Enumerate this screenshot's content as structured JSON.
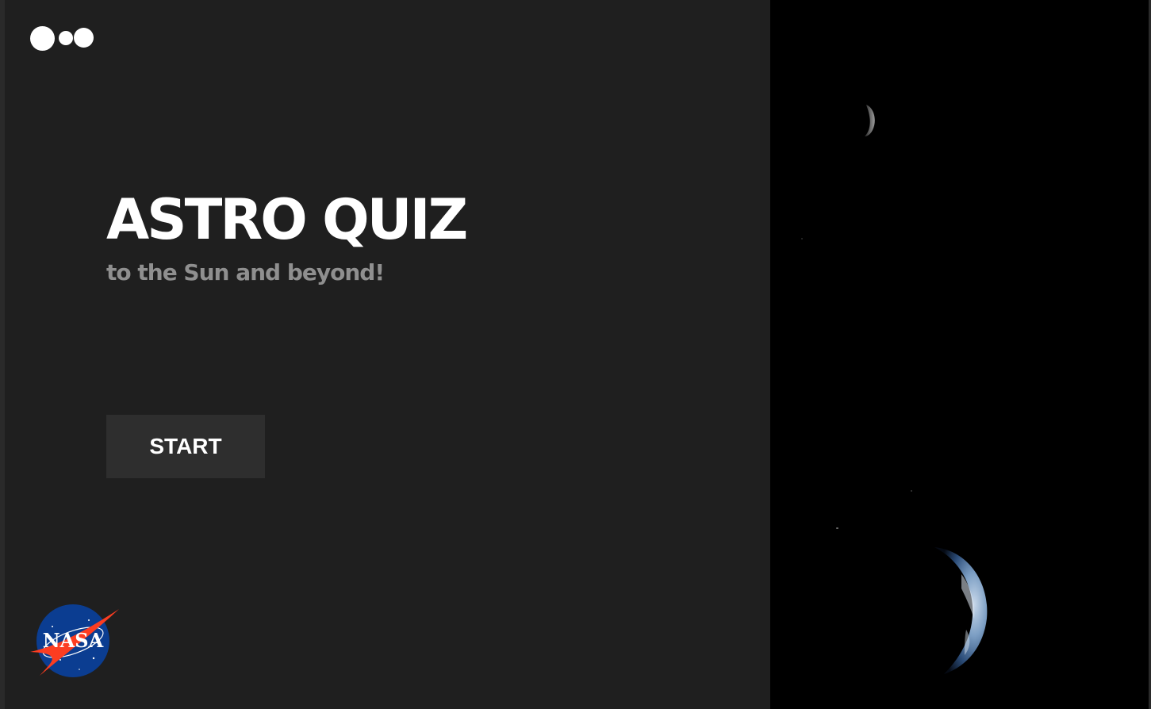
{
  "app": {
    "title": "ASTRO QUIZ",
    "subtitle": "to the Sun and beyond!"
  },
  "actions": {
    "start_label": "START"
  },
  "branding": {
    "logo_icon": "three-dots-logo-icon",
    "nasa_logo_text": "NASA",
    "nasa_logo_icon": "nasa-meatball-logo-icon"
  },
  "imagery": {
    "moon_icon": "moon-icon",
    "earth_icon": "earth-icon"
  },
  "colors": {
    "background": "#1f1f1f",
    "space": "#000000",
    "title": "#ffffff",
    "subtitle": "#8f8f8f",
    "button_bg": "#2e2e2e",
    "nasa_blue": "#0b3d91",
    "nasa_red": "#fc3d21"
  }
}
